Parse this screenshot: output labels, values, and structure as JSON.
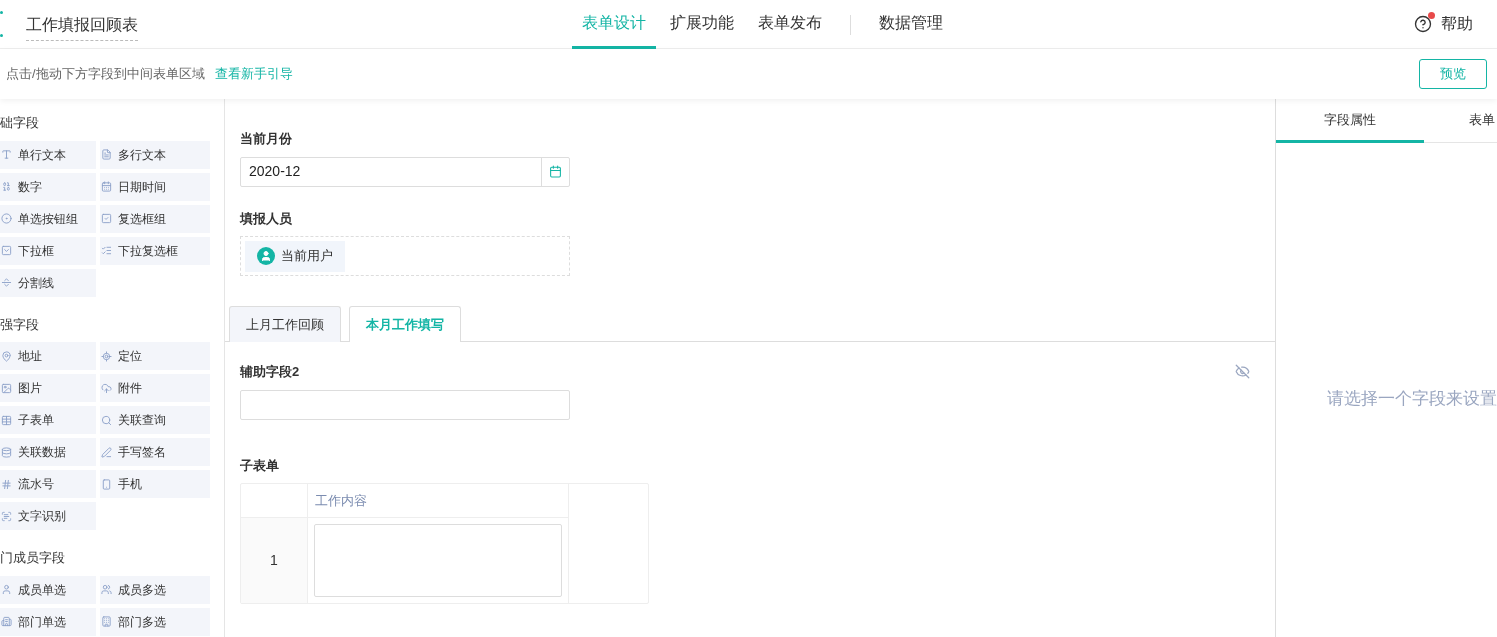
{
  "header": {
    "title": "工作填报回顾表",
    "nav": [
      {
        "label": "表单设计",
        "selected": true
      },
      {
        "label": "扩展功能",
        "selected": false
      },
      {
        "label": "表单发布",
        "selected": false
      },
      {
        "label": "数据管理",
        "selected": false
      }
    ],
    "help": {
      "label": "帮助",
      "notification": true
    }
  },
  "toolbar": {
    "hint": "点击/拖动下方字段到中间表单区域",
    "guide_link": "查看新手引导",
    "preview_button": "预览"
  },
  "sidebar": {
    "groups": [
      {
        "title": "础字段",
        "items": [
          "单行文本",
          "多行文本",
          "数字",
          "日期时间",
          "单选按钮组",
          "复选框组",
          "下拉框",
          "下拉复选框",
          "分割线"
        ]
      },
      {
        "title": "强字段",
        "items": [
          "地址",
          "定位",
          "图片",
          "附件",
          "子表单",
          "关联查询",
          "关联数据",
          "手写签名",
          "流水号",
          "手机",
          "文字识别"
        ]
      },
      {
        "title": "门成员字段",
        "items": [
          "成员单选",
          "成员多选",
          "部门单选",
          "部门多选"
        ]
      }
    ]
  },
  "form": {
    "month_field": {
      "label": "当前月份",
      "value": "2020-12"
    },
    "reporter_field": {
      "label": "填报人员",
      "user": "当前用户"
    },
    "tabs": [
      {
        "label": "上月工作回顾",
        "selected": false
      },
      {
        "label": "本月工作填写",
        "selected": true
      }
    ],
    "aux_field": {
      "label": "辅助字段2",
      "hidden": true
    },
    "subform": {
      "label": "子表单",
      "columns": [
        "工作内容"
      ],
      "rows": [
        "1"
      ]
    }
  },
  "properties": {
    "tabs": [
      {
        "label": "字段属性",
        "selected": true
      },
      {
        "label": "表单",
        "selected": false
      }
    ],
    "empty_hint": "请选择一个字段来设置"
  }
}
